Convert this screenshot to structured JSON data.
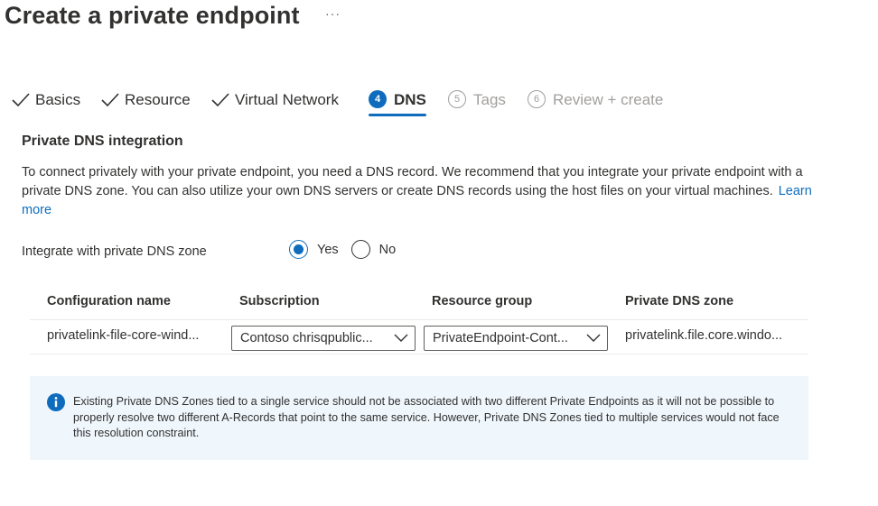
{
  "header": {
    "title": "Create a private endpoint",
    "more_label": "···"
  },
  "tabs": [
    {
      "label": "Basics",
      "state": "done"
    },
    {
      "label": "Resource",
      "state": "done"
    },
    {
      "label": "Virtual Network",
      "state": "done"
    },
    {
      "number": "4",
      "label": "DNS",
      "state": "active"
    },
    {
      "number": "5",
      "label": "Tags",
      "state": "disabled"
    },
    {
      "number": "6",
      "label": "Review + create",
      "state": "disabled"
    }
  ],
  "section": {
    "title": "Private DNS integration",
    "description": "To connect privately with your private endpoint, you need a DNS record. We recommend that you integrate your private endpoint with a private DNS zone. You can also utilize your own DNS servers or create DNS records using the host files on your virtual machines.",
    "learn_more": "Learn more"
  },
  "integrate": {
    "label": "Integrate with private DNS zone",
    "options": [
      {
        "label": "Yes",
        "selected": true
      },
      {
        "label": "No",
        "selected": false
      }
    ]
  },
  "table": {
    "headers": [
      "Configuration name",
      "Subscription",
      "Resource group",
      "Private DNS zone"
    ],
    "rows": [
      {
        "configuration_name": "privatelink-file-core-wind...",
        "subscription": "Contoso chrisqpublic...",
        "resource_group": "PrivateEndpoint-Cont...",
        "private_dns_zone": "privatelink.file.core.windo..."
      }
    ]
  },
  "info": {
    "text": "Existing Private DNS Zones tied to a single service should not be associated with two different Private Endpoints as it will not be possible to properly resolve two different A-Records that point to the same service. However, Private DNS Zones tied to multiple services would not face this resolution constraint."
  },
  "colors": {
    "accent": "#0f6cbd",
    "text": "#323130",
    "disabled": "#a19f9d",
    "info_background": "#eff6fc"
  }
}
